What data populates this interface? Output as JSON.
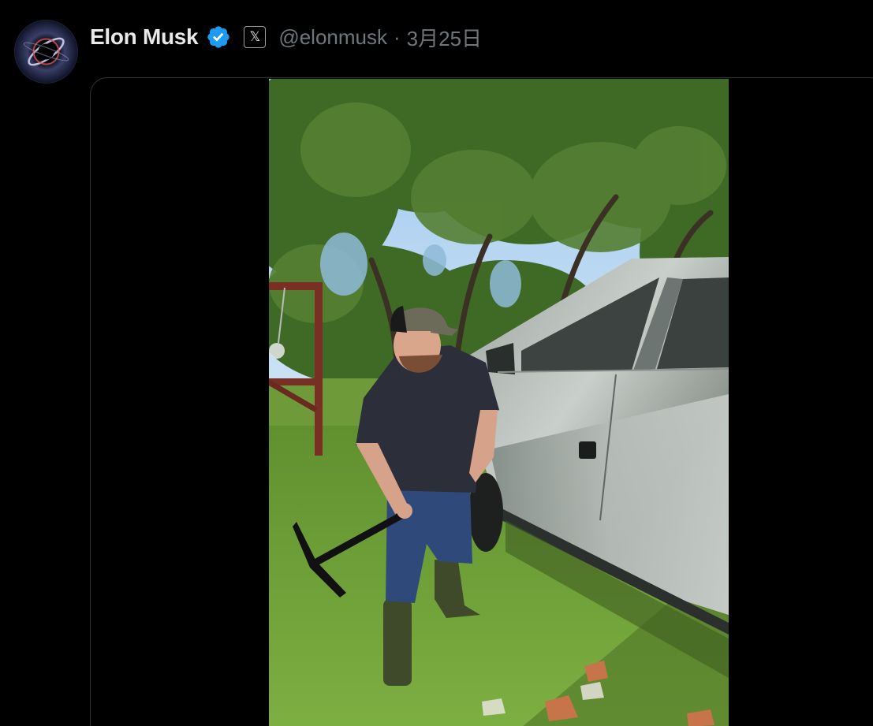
{
  "author": {
    "name": "Elon Musk",
    "handle": "@elonmusk",
    "separator": "·",
    "date": "3月25日",
    "verified_icon": "verified-badge-icon",
    "affiliate_icon": "x-logo-icon"
  },
  "media": {
    "type": "video",
    "icon": "video-frame"
  },
  "colors": {
    "background": "#000000",
    "name_text": "#e7e9ea",
    "secondary_text": "#71767b",
    "verified_blue": "#1d9bf0",
    "card_border": "#2f3336"
  }
}
